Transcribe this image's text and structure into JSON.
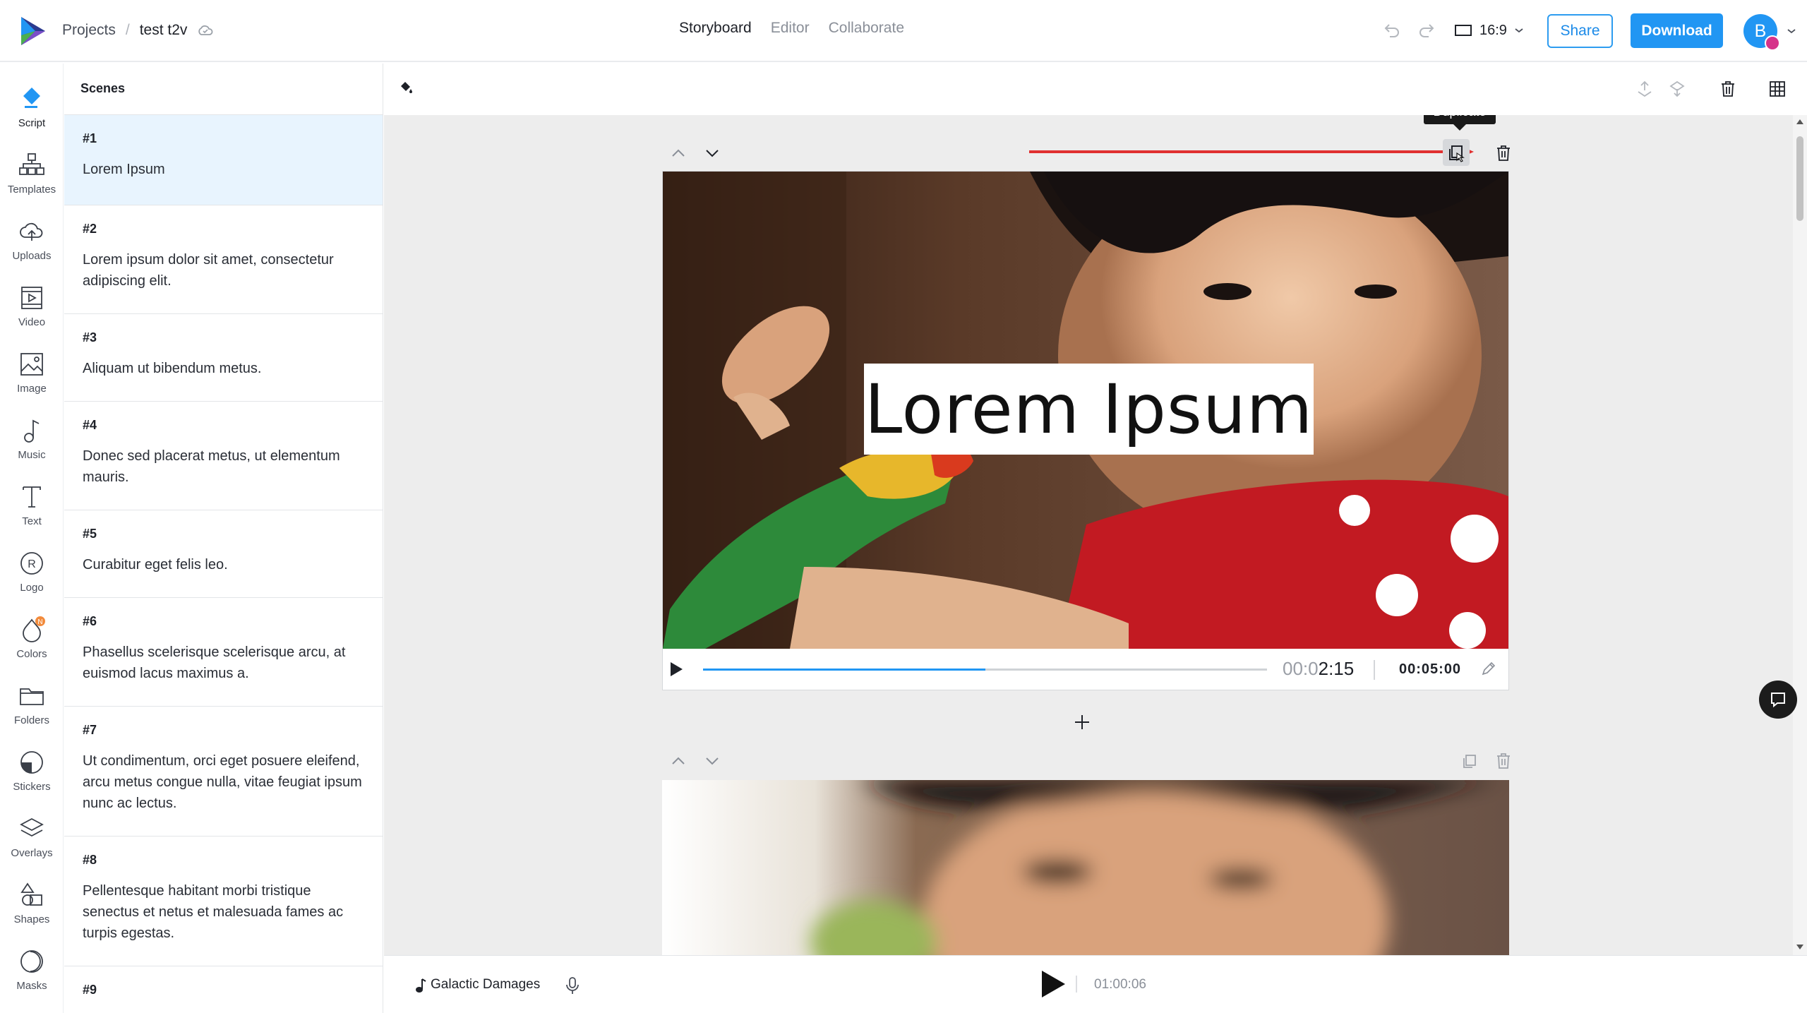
{
  "app": {
    "breadcrumb_root": "Projects",
    "breadcrumb_separator": "/",
    "project_name": "test t2v"
  },
  "header": {
    "tabs": [
      {
        "label": "Storyboard",
        "active": true
      },
      {
        "label": "Editor",
        "active": false
      },
      {
        "label": "Collaborate",
        "active": false
      }
    ],
    "aspect_ratio": "16:9",
    "share_label": "Share",
    "download_label": "Download",
    "avatar_initial": "B",
    "accent_color": "#2196f3"
  },
  "rail": [
    {
      "label": "Script",
      "icon": "script-icon",
      "active": true
    },
    {
      "label": "Templates",
      "icon": "templates-icon"
    },
    {
      "label": "Uploads",
      "icon": "upload-cloud-icon"
    },
    {
      "label": "Video",
      "icon": "video-icon"
    },
    {
      "label": "Image",
      "icon": "image-icon"
    },
    {
      "label": "Music",
      "icon": "music-icon"
    },
    {
      "label": "Text",
      "icon": "text-icon"
    },
    {
      "label": "Logo",
      "icon": "logo-icon"
    },
    {
      "label": "Colors",
      "icon": "colors-icon",
      "badge": "N"
    },
    {
      "label": "Folders",
      "icon": "folder-icon"
    },
    {
      "label": "Stickers",
      "icon": "sticker-icon"
    },
    {
      "label": "Overlays",
      "icon": "overlays-icon"
    },
    {
      "label": "Shapes",
      "icon": "shapes-icon"
    },
    {
      "label": "Masks",
      "icon": "masks-icon"
    }
  ],
  "scenes_panel": {
    "title": "Scenes",
    "items": [
      {
        "num": "#1",
        "text": "Lorem Ipsum"
      },
      {
        "num": "#2",
        "text": "Lorem ipsum dolor sit amet, consectetur adipiscing elit."
      },
      {
        "num": "#3",
        "text": "Aliquam ut bibendum metus."
      },
      {
        "num": "#4",
        "text": "Donec sed placerat metus, ut elementum mauris."
      },
      {
        "num": "#5",
        "text": "Curabitur eget felis leo."
      },
      {
        "num": "#6",
        "text": "Phasellus scelerisque scelerisque arcu, at euismod lacus maximus a."
      },
      {
        "num": "#7",
        "text": "Ut condimentum, orci eget posuere eleifend, arcu metus congue nulla, vitae feugiat ipsum nunc ac lectus."
      },
      {
        "num": "#8",
        "text": "Pellentesque habitant morbi tristique senectus et netus et malesuada fames ac turpis egestas."
      },
      {
        "num": "#9",
        "text": ""
      }
    ]
  },
  "scene_card": {
    "title_overlay": "Lorem Ipsum",
    "tooltip": "Duplicate",
    "time_current_dim": "00:0",
    "time_current": "2:15",
    "time_total": "00:05:00",
    "progress": 0.5
  },
  "bottom": {
    "music_title": "Galactic Damages",
    "time": "01:00:06"
  }
}
